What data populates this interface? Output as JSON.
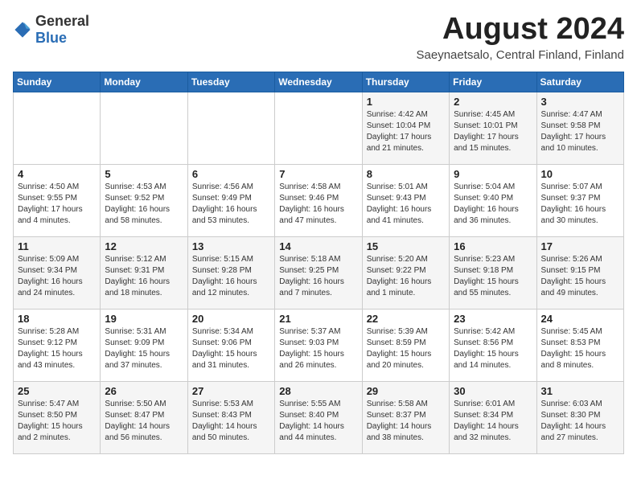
{
  "header": {
    "logo_general": "General",
    "logo_blue": "Blue",
    "title": "August 2024",
    "subtitle": "Saeynaetsalo, Central Finland, Finland"
  },
  "weekdays": [
    "Sunday",
    "Monday",
    "Tuesday",
    "Wednesday",
    "Thursday",
    "Friday",
    "Saturday"
  ],
  "weeks": [
    [
      {
        "day": "",
        "info": ""
      },
      {
        "day": "",
        "info": ""
      },
      {
        "day": "",
        "info": ""
      },
      {
        "day": "",
        "info": ""
      },
      {
        "day": "1",
        "info": "Sunrise: 4:42 AM\nSunset: 10:04 PM\nDaylight: 17 hours\nand 21 minutes."
      },
      {
        "day": "2",
        "info": "Sunrise: 4:45 AM\nSunset: 10:01 PM\nDaylight: 17 hours\nand 15 minutes."
      },
      {
        "day": "3",
        "info": "Sunrise: 4:47 AM\nSunset: 9:58 PM\nDaylight: 17 hours\nand 10 minutes."
      }
    ],
    [
      {
        "day": "4",
        "info": "Sunrise: 4:50 AM\nSunset: 9:55 PM\nDaylight: 17 hours\nand 4 minutes."
      },
      {
        "day": "5",
        "info": "Sunrise: 4:53 AM\nSunset: 9:52 PM\nDaylight: 16 hours\nand 58 minutes."
      },
      {
        "day": "6",
        "info": "Sunrise: 4:56 AM\nSunset: 9:49 PM\nDaylight: 16 hours\nand 53 minutes."
      },
      {
        "day": "7",
        "info": "Sunrise: 4:58 AM\nSunset: 9:46 PM\nDaylight: 16 hours\nand 47 minutes."
      },
      {
        "day": "8",
        "info": "Sunrise: 5:01 AM\nSunset: 9:43 PM\nDaylight: 16 hours\nand 41 minutes."
      },
      {
        "day": "9",
        "info": "Sunrise: 5:04 AM\nSunset: 9:40 PM\nDaylight: 16 hours\nand 36 minutes."
      },
      {
        "day": "10",
        "info": "Sunrise: 5:07 AM\nSunset: 9:37 PM\nDaylight: 16 hours\nand 30 minutes."
      }
    ],
    [
      {
        "day": "11",
        "info": "Sunrise: 5:09 AM\nSunset: 9:34 PM\nDaylight: 16 hours\nand 24 minutes."
      },
      {
        "day": "12",
        "info": "Sunrise: 5:12 AM\nSunset: 9:31 PM\nDaylight: 16 hours\nand 18 minutes."
      },
      {
        "day": "13",
        "info": "Sunrise: 5:15 AM\nSunset: 9:28 PM\nDaylight: 16 hours\nand 12 minutes."
      },
      {
        "day": "14",
        "info": "Sunrise: 5:18 AM\nSunset: 9:25 PM\nDaylight: 16 hours\nand 7 minutes."
      },
      {
        "day": "15",
        "info": "Sunrise: 5:20 AM\nSunset: 9:22 PM\nDaylight: 16 hours\nand 1 minute."
      },
      {
        "day": "16",
        "info": "Sunrise: 5:23 AM\nSunset: 9:18 PM\nDaylight: 15 hours\nand 55 minutes."
      },
      {
        "day": "17",
        "info": "Sunrise: 5:26 AM\nSunset: 9:15 PM\nDaylight: 15 hours\nand 49 minutes."
      }
    ],
    [
      {
        "day": "18",
        "info": "Sunrise: 5:28 AM\nSunset: 9:12 PM\nDaylight: 15 hours\nand 43 minutes."
      },
      {
        "day": "19",
        "info": "Sunrise: 5:31 AM\nSunset: 9:09 PM\nDaylight: 15 hours\nand 37 minutes."
      },
      {
        "day": "20",
        "info": "Sunrise: 5:34 AM\nSunset: 9:06 PM\nDaylight: 15 hours\nand 31 minutes."
      },
      {
        "day": "21",
        "info": "Sunrise: 5:37 AM\nSunset: 9:03 PM\nDaylight: 15 hours\nand 26 minutes."
      },
      {
        "day": "22",
        "info": "Sunrise: 5:39 AM\nSunset: 8:59 PM\nDaylight: 15 hours\nand 20 minutes."
      },
      {
        "day": "23",
        "info": "Sunrise: 5:42 AM\nSunset: 8:56 PM\nDaylight: 15 hours\nand 14 minutes."
      },
      {
        "day": "24",
        "info": "Sunrise: 5:45 AM\nSunset: 8:53 PM\nDaylight: 15 hours\nand 8 minutes."
      }
    ],
    [
      {
        "day": "25",
        "info": "Sunrise: 5:47 AM\nSunset: 8:50 PM\nDaylight: 15 hours\nand 2 minutes."
      },
      {
        "day": "26",
        "info": "Sunrise: 5:50 AM\nSunset: 8:47 PM\nDaylight: 14 hours\nand 56 minutes."
      },
      {
        "day": "27",
        "info": "Sunrise: 5:53 AM\nSunset: 8:43 PM\nDaylight: 14 hours\nand 50 minutes."
      },
      {
        "day": "28",
        "info": "Sunrise: 5:55 AM\nSunset: 8:40 PM\nDaylight: 14 hours\nand 44 minutes."
      },
      {
        "day": "29",
        "info": "Sunrise: 5:58 AM\nSunset: 8:37 PM\nDaylight: 14 hours\nand 38 minutes."
      },
      {
        "day": "30",
        "info": "Sunrise: 6:01 AM\nSunset: 8:34 PM\nDaylight: 14 hours\nand 32 minutes."
      },
      {
        "day": "31",
        "info": "Sunrise: 6:03 AM\nSunset: 8:30 PM\nDaylight: 14 hours\nand 27 minutes."
      }
    ]
  ]
}
